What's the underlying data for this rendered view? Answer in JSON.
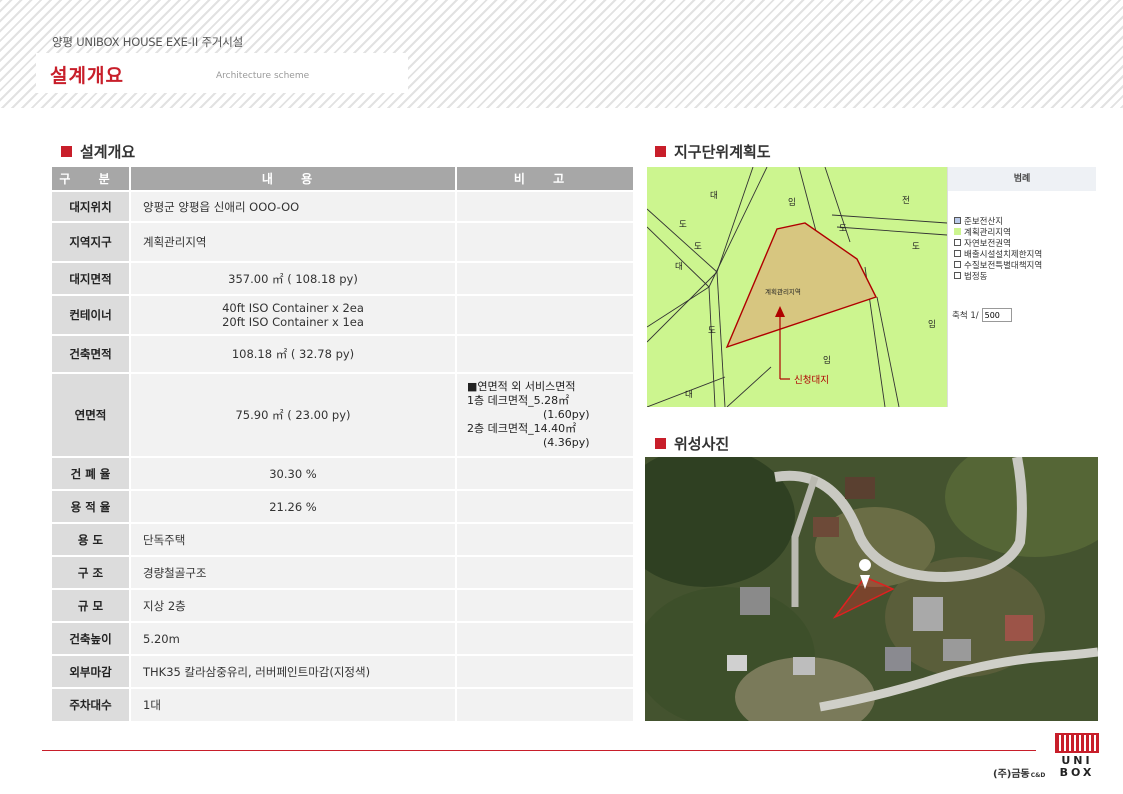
{
  "header": {
    "subtitle": "양평 UNIBOX HOUSE EXE-II 주거시설",
    "title": "설계개요",
    "title_en": "Architecture scheme"
  },
  "left_section": {
    "heading": "설계개요"
  },
  "table": {
    "headers": [
      "구 분",
      "내 용",
      "비 고"
    ],
    "rows": [
      {
        "label": "대지위치",
        "value": "양평군 양평읍 신애리 OOO-OO",
        "note": ""
      },
      {
        "label": "지역지구",
        "value": "계획관리지역",
        "note": ""
      },
      {
        "label": "대지면적",
        "value": "357.00 ㎡ ( 108.18 py)",
        "note": ""
      },
      {
        "label": "컨테이너",
        "value_lines": [
          "40ft ISO Container x 2ea",
          "20ft ISO Container x 1ea"
        ],
        "note": ""
      },
      {
        "label": "건축면적",
        "value": "108.18 ㎡ ( 32.78 py)",
        "note": ""
      },
      {
        "label": "연면적",
        "value": "75.90 ㎡ ( 23.00 py)",
        "note_lines": [
          "■연면적 외 서비스면적",
          "1층 데크면적_5.28㎡",
          "(1.60py)",
          "2층 데크면적_14.40㎡",
          "(4.36py)"
        ]
      },
      {
        "label": "건 폐 율",
        "value": "30.30 %",
        "note": ""
      },
      {
        "label": "용 적 율",
        "value": "21.26 %",
        "note": ""
      },
      {
        "label": "용 도",
        "value": "단독주택",
        "note": ""
      },
      {
        "label": "구 조",
        "value": "경량철골구조",
        "note": ""
      },
      {
        "label": "규 모",
        "value": "지상 2층",
        "note": ""
      },
      {
        "label": "건축높이",
        "value": "5.20m",
        "note": ""
      },
      {
        "label": "외부마감",
        "value": "THK35 칼라삼중유리, 러버페인트마감(지정색)",
        "note": ""
      },
      {
        "label": "주차대수",
        "value": "1대",
        "note": ""
      }
    ]
  },
  "zoning": {
    "heading": "지구단위계획도",
    "map_labels": {
      "t1": "대",
      "t2": "임",
      "t3": "전",
      "t4": "도",
      "t5": "도",
      "t6": "대",
      "t7": "도",
      "t8": "임",
      "t9": "임",
      "t10": "대",
      "t11": "도",
      "t12": "도"
    },
    "parcel_label": "계획관리지역",
    "site_label": "신청대지",
    "legend": {
      "title": "범례",
      "items": [
        "준보전산지",
        "계획관리지역",
        "자연보전권역",
        "배출시설설치제한지역",
        "수질보전특별대책지역",
        "법정동"
      ],
      "scale_label": "축척 1/",
      "scale_value": "500"
    },
    "colors": {
      "zone_green": "#ccf58f",
      "parcel_fill": "#d7c680",
      "parcel_stroke": "#b00000"
    }
  },
  "satellite": {
    "heading": "위성사진"
  },
  "footer": {
    "company": "(주)금동",
    "company_suffix": "C&D",
    "logo_top": "UNI",
    "logo_bottom": "BOX"
  },
  "colors": {
    "accent": "#c81e2a",
    "table_header": "#a7a7a7",
    "label_cell": "#dcdcdc",
    "value_cell": "#f2f2f2"
  }
}
